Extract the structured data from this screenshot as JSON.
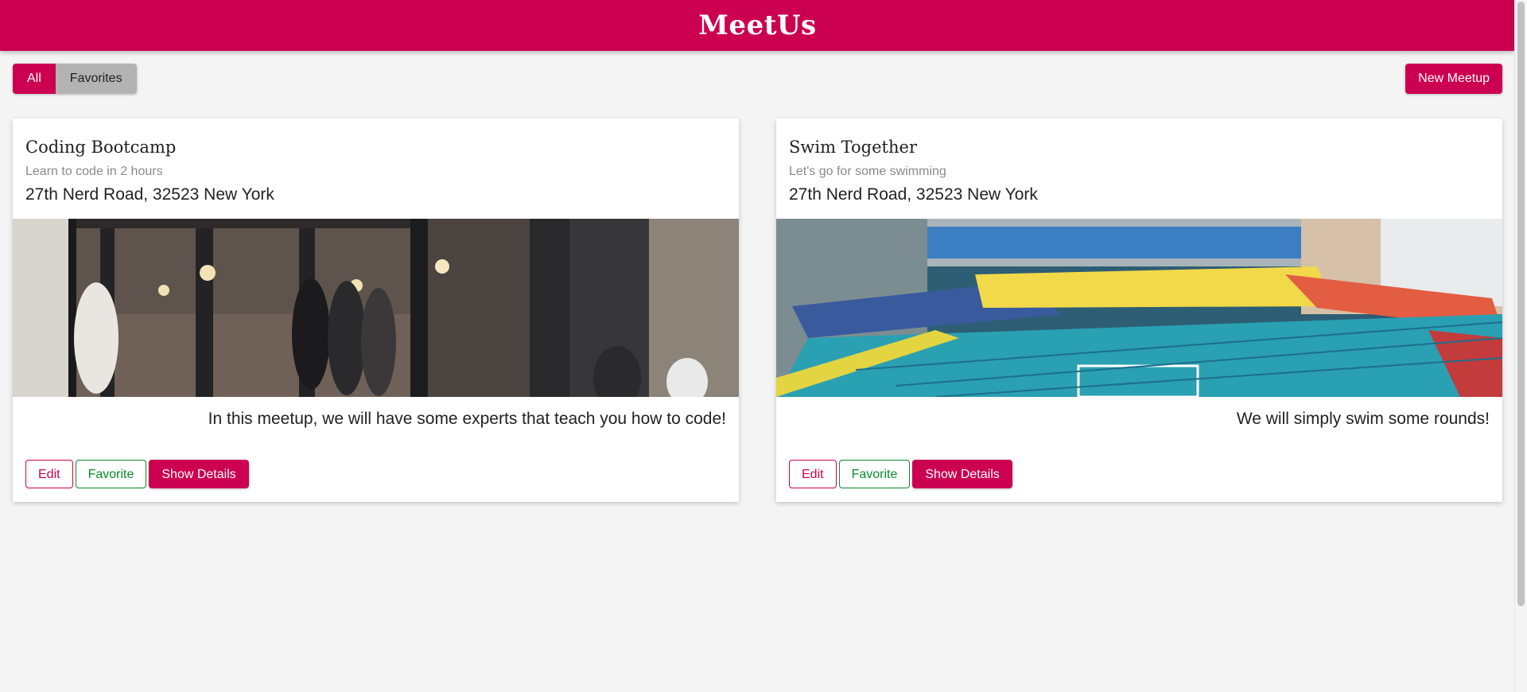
{
  "app": {
    "title": "MeetUs"
  },
  "filter": {
    "all_label": "All",
    "favorites_label": "Favorites"
  },
  "new_meetup_label": "New Meetup",
  "meetups": [
    {
      "title": "Coding Bootcamp",
      "subtitle": "Learn to code in 2 hours",
      "address": "27th Nerd Road, 32523 New York",
      "description": "In this meetup, we will have some experts that teach you how to code!",
      "image_alt": "coffee-shop-street-photo",
      "actions": {
        "edit": "Edit",
        "favorite": "Favorite",
        "details": "Show Details"
      }
    },
    {
      "title": "Swim Together",
      "subtitle": "Let's go for some swimming",
      "address": "27th Nerd Road, 32523 New York",
      "description": "We will simply swim some rounds!",
      "image_alt": "indoor-swimming-pool-photo",
      "actions": {
        "edit": "Edit",
        "favorite": "Favorite",
        "details": "Show Details"
      }
    }
  ],
  "colors": {
    "primary": "#cc0050",
    "favorite": "#0a8a2a",
    "background": "#f4f4f4"
  }
}
